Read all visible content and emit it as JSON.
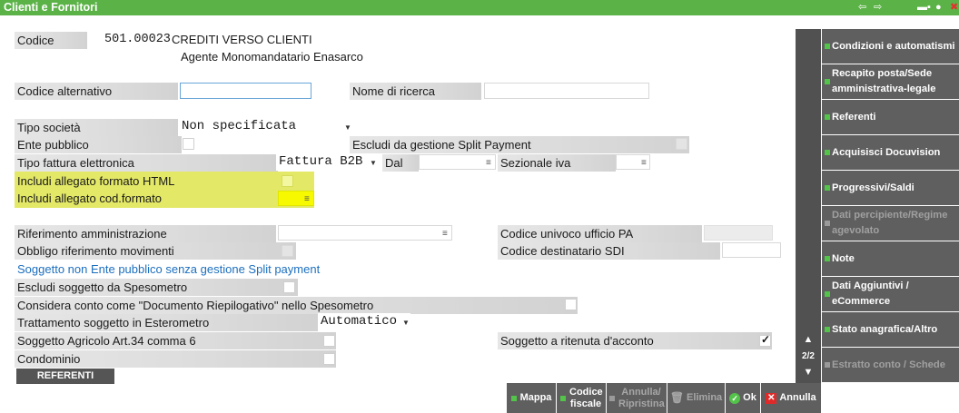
{
  "window": {
    "title": "Clienti e Fornitori"
  },
  "header": {
    "codice_label": "Codice",
    "codice_value": "501.00023",
    "descrizione": "CREDITI VERSO CLIENTI",
    "agente": "Agente Monomandatario Enasarco"
  },
  "fields": {
    "codice_alternativo": "Codice alternativo",
    "nome_di_ricerca": "Nome di ricerca",
    "tipo_societa": "Tipo società",
    "tipo_societa_value": "Non specificata",
    "ente_pubblico": "Ente pubblico",
    "escludi_split": "Escludi da gestione Split Payment",
    "tipo_fattura": "Tipo fattura elettronica",
    "tipo_fattura_value": "Fattura B2B",
    "dal": "Dal",
    "sezionale_iva": "Sezionale iva",
    "allegato_html": "Includi allegato formato HTML",
    "allegato_cod_formato": "Includi allegato cod.formato",
    "riferimento_amministrazione": "Riferimento amministrazione",
    "codice_univoco_pa": "Codice univoco ufficio PA",
    "obbligo_riferimento": "Obbligo riferimento movimenti",
    "codice_destinatario_sdi": "Codice destinatario SDI",
    "soggetto_link": "Soggetto non Ente pubblico senza gestione Split payment",
    "escludi_spesometro": "Escludi soggetto da Spesometro",
    "considera_conto": "Considera conto come \"Documento Riepilogativo\" nello Spesometro",
    "trattamento_esterometro": "Trattamento soggetto in Esterometro",
    "trattamento_value": "Automatico",
    "soggetto_agricolo": "Soggetto Agricolo Art.34 comma 6",
    "soggetto_ritenuta": "Soggetto a ritenuta d'acconto",
    "condominio": "Condominio",
    "referenti_button": "REFERENTI"
  },
  "checkboxes": {
    "ritenuta_checked": true
  },
  "pager": {
    "page": "2/2"
  },
  "sidebar": {
    "items": [
      {
        "label": "Condizioni e automatismi",
        "enabled": true
      },
      {
        "label": "Recapito posta/Sede amministrativa-legale",
        "enabled": true
      },
      {
        "label": "Referenti",
        "enabled": true
      },
      {
        "label": "Acquisisci Docuvision",
        "enabled": true
      },
      {
        "label": "Progressivi/Saldi",
        "enabled": true
      },
      {
        "label": "Dati percipiente/Regime agevolato",
        "enabled": false
      },
      {
        "label": "Note",
        "enabled": true
      },
      {
        "label": "Dati Aggiuntivi / eCommerce",
        "enabled": true
      },
      {
        "label": "Stato anagrafica/Altro",
        "enabled": true
      },
      {
        "label": "Estratto conto / Schede",
        "enabled": false
      }
    ]
  },
  "footer": {
    "mappa": "Mappa",
    "codice_fiscale": "Codice fiscale",
    "annulla_ripristina": "Annulla/ Ripristina",
    "elimina": "Elimina",
    "ok": "Ok",
    "annulla": "Annulla"
  },
  "colors": {
    "titlebar": "#5bb247",
    "highlight": "#e3e867",
    "button_bg": "#5f5f5f",
    "accent_green": "#53c34a",
    "link": "#1c6fbf"
  }
}
